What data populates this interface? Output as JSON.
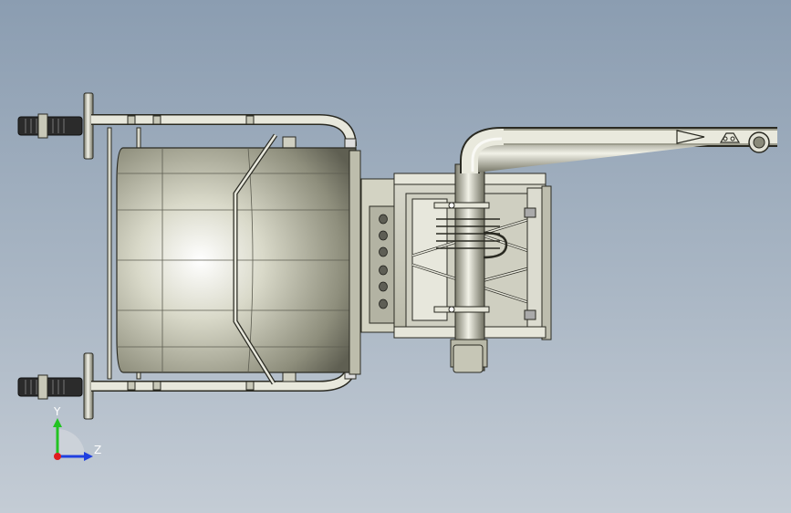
{
  "triad": {
    "y_label": "Y",
    "z_label": "Z",
    "y_color": "#22c322",
    "z_color": "#1f3fe0",
    "x_color": "#e01d1d"
  },
  "model": {
    "metal_light": "#e4e4d8",
    "metal_mid": "#c8c8b8",
    "metal_dark": "#8a8a78",
    "edge_color": "#2a2a22",
    "tire_color": "#2b2b2b"
  }
}
